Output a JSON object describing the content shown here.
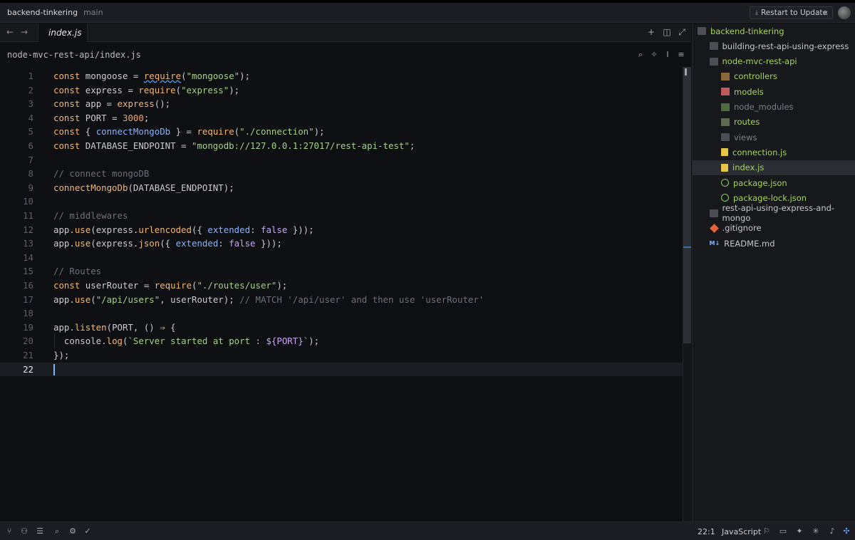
{
  "titlebar": {
    "project": "backend-tinkering",
    "branch": "main",
    "restart_label": "Restart to Update",
    "restart_icon": "download-icon",
    "close": "×"
  },
  "tabbar": {
    "back": "←",
    "forward": "→",
    "active_tab": "index.js",
    "add": "+",
    "split": "◫",
    "expand": "⤢"
  },
  "breadcrumb": {
    "path": "node-mvc-rest-api/index.js"
  },
  "editor": {
    "language": "JavaScript",
    "cursor_position": "22:1",
    "active_line": 22
  },
  "code_lines": [
    {
      "n": "1",
      "html_tokens": [
        [
          "kw",
          "const"
        ],
        [
          "t",
          " mongoose = "
        ],
        [
          "fn",
          "require"
        ],
        [
          "t",
          "("
        ],
        [
          "str",
          "\"mongoose\""
        ],
        [
          "t",
          ");"
        ]
      ]
    },
    {
      "n": "2",
      "html_tokens": [
        [
          "kw",
          "const"
        ],
        [
          "t",
          " express = "
        ],
        [
          "fn",
          "require"
        ],
        [
          "t",
          "("
        ],
        [
          "str",
          "\"express\""
        ],
        [
          "t",
          ");"
        ]
      ]
    },
    {
      "n": "3",
      "html_tokens": [
        [
          "kw",
          "const"
        ],
        [
          "t",
          " app = "
        ],
        [
          "fn",
          "express"
        ],
        [
          "t",
          "();"
        ]
      ]
    },
    {
      "n": "4",
      "html_tokens": [
        [
          "kw",
          "const"
        ],
        [
          "t",
          " PORT = "
        ],
        [
          "num",
          "3000"
        ],
        [
          "t",
          ";"
        ]
      ]
    },
    {
      "n": "5",
      "html_tokens": [
        [
          "kw",
          "const"
        ],
        [
          "t",
          " { "
        ],
        [
          "prop",
          "connectMongoDb"
        ],
        [
          "t",
          " } = "
        ],
        [
          "fn",
          "require"
        ],
        [
          "t",
          "("
        ],
        [
          "str",
          "\"./connection\""
        ],
        [
          "t",
          ");"
        ]
      ]
    },
    {
      "n": "6",
      "html_tokens": [
        [
          "kw",
          "const"
        ],
        [
          "t",
          " DATABASE_ENDPOINT = "
        ],
        [
          "str",
          "\"mongodb://127.0.0.1:27017/rest-api-test\""
        ],
        [
          "t",
          ";"
        ]
      ]
    },
    {
      "n": "7",
      "html_tokens": []
    },
    {
      "n": "8",
      "html_tokens": [
        [
          "cm",
          "// connect mongoDB"
        ]
      ]
    },
    {
      "n": "9",
      "html_tokens": [
        [
          "fn",
          "connectMongoDb"
        ],
        [
          "t",
          "(DATABASE_ENDPOINT);"
        ]
      ]
    },
    {
      "n": "10",
      "html_tokens": []
    },
    {
      "n": "11",
      "html_tokens": [
        [
          "cm",
          "// middlewares"
        ]
      ]
    },
    {
      "n": "12",
      "html_tokens": [
        [
          "t",
          "app."
        ],
        [
          "fn",
          "use"
        ],
        [
          "t",
          "(express."
        ],
        [
          "fn",
          "urlencoded"
        ],
        [
          "t",
          "({ "
        ],
        [
          "prop",
          "extended"
        ],
        [
          "t",
          ": "
        ],
        [
          "const",
          "false"
        ],
        [
          "t",
          " }));"
        ]
      ]
    },
    {
      "n": "13",
      "html_tokens": [
        [
          "t",
          "app."
        ],
        [
          "fn",
          "use"
        ],
        [
          "t",
          "(express."
        ],
        [
          "fn",
          "json"
        ],
        [
          "t",
          "({ "
        ],
        [
          "prop",
          "extended"
        ],
        [
          "t",
          ": "
        ],
        [
          "const",
          "false"
        ],
        [
          "t",
          " }));"
        ]
      ]
    },
    {
      "n": "14",
      "html_tokens": []
    },
    {
      "n": "15",
      "html_tokens": [
        [
          "cm",
          "// Routes"
        ]
      ]
    },
    {
      "n": "16",
      "html_tokens": [
        [
          "kw",
          "const"
        ],
        [
          "t",
          " userRouter = "
        ],
        [
          "fn",
          "require"
        ],
        [
          "t",
          "("
        ],
        [
          "str",
          "\"./routes/user\""
        ],
        [
          "t",
          ");"
        ]
      ]
    },
    {
      "n": "17",
      "html_tokens": [
        [
          "t",
          "app."
        ],
        [
          "fn",
          "use"
        ],
        [
          "t",
          "("
        ],
        [
          "str",
          "\"/api/users\""
        ],
        [
          "t",
          ", userRouter); "
        ],
        [
          "cm",
          "// MATCH '/api/user' and then use 'userRouter'"
        ]
      ]
    },
    {
      "n": "18",
      "html_tokens": []
    },
    {
      "n": "19",
      "html_tokens": [
        [
          "t",
          "app."
        ],
        [
          "fn",
          "listen"
        ],
        [
          "t",
          "(PORT, () "
        ],
        [
          "kw",
          "⇒"
        ],
        [
          "t",
          " {"
        ]
      ]
    },
    {
      "n": "20",
      "html_tokens": [
        [
          "t",
          "  console."
        ],
        [
          "fn",
          "log"
        ],
        [
          "t",
          "("
        ],
        [
          "str",
          "`Server started at port : "
        ],
        [
          "var",
          "${PORT}"
        ],
        [
          "str",
          "`"
        ],
        [
          "t",
          ");"
        ]
      ]
    },
    {
      "n": "21",
      "html_tokens": [
        [
          "t",
          "});"
        ]
      ]
    },
    {
      "n": "22",
      "html_tokens": []
    }
  ],
  "file_tree": [
    {
      "label": "backend-tinkering",
      "depth": 0,
      "icon": "folder-open-icon",
      "style": "green"
    },
    {
      "label": "building-rest-api-using-express",
      "depth": 1,
      "icon": "folder-icon",
      "style": "plain"
    },
    {
      "label": "node-mvc-rest-api",
      "depth": 1,
      "icon": "folder-open-icon",
      "style": "green"
    },
    {
      "label": "controllers",
      "depth": 2,
      "icon": "controllers-folder-icon",
      "style": "green"
    },
    {
      "label": "models",
      "depth": 2,
      "icon": "models-folder-icon",
      "style": "green"
    },
    {
      "label": "node_modules",
      "depth": 2,
      "icon": "node-modules-folder-icon",
      "style": "dim"
    },
    {
      "label": "routes",
      "depth": 2,
      "icon": "routes-folder-icon",
      "style": "green"
    },
    {
      "label": "views",
      "depth": 2,
      "icon": "folder-icon",
      "style": "dim"
    },
    {
      "label": "connection.js",
      "depth": 2,
      "icon": "js-file-icon",
      "style": "green"
    },
    {
      "label": "index.js",
      "depth": 2,
      "icon": "js-file-icon",
      "style": "green",
      "selected": true
    },
    {
      "label": "package.json",
      "depth": 2,
      "icon": "json-file-icon",
      "style": "green"
    },
    {
      "label": "package-lock.json",
      "depth": 2,
      "icon": "json-file-icon",
      "style": "green"
    },
    {
      "label": "rest-api-using-express-and-mongo",
      "depth": 1,
      "icon": "folder-icon",
      "style": "plain"
    },
    {
      "label": ".gitignore",
      "depth": 1,
      "icon": "git-icon",
      "style": "plain"
    },
    {
      "label": "README.md",
      "depth": 1,
      "icon": "markdown-icon",
      "style": "plain",
      "badge": "M↓"
    }
  ],
  "statusbar": {
    "position": "22:1",
    "language": "JavaScript"
  }
}
